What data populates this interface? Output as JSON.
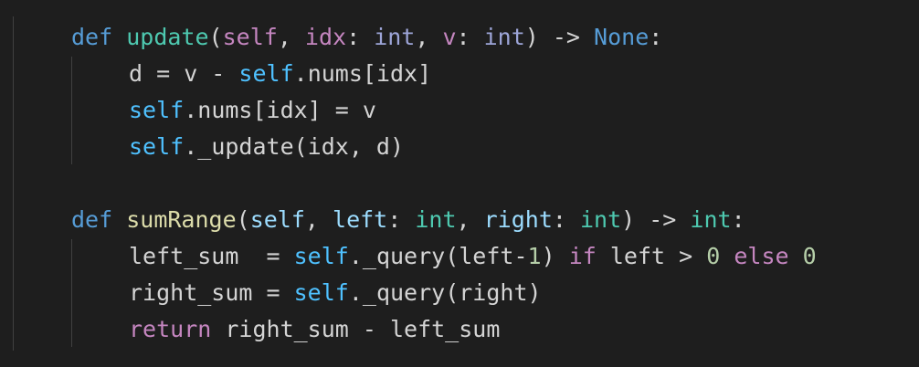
{
  "editor": {
    "language": "python",
    "theme": "dark",
    "lines": [
      {
        "indent": 1,
        "tokens": [
          {
            "t": "def",
            "k": "kw"
          },
          {
            "t": " ",
            "k": "txt"
          },
          {
            "t": "update",
            "k": "fn"
          },
          {
            "t": "(",
            "k": "txt"
          },
          {
            "t": "self",
            "k": "slf"
          },
          {
            "t": ", ",
            "k": "txt"
          },
          {
            "t": "idx",
            "k": "slf"
          },
          {
            "t": ": ",
            "k": "txt"
          },
          {
            "t": "int",
            "k": "typ"
          },
          {
            "t": ", ",
            "k": "txt"
          },
          {
            "t": "v",
            "k": "slf"
          },
          {
            "t": ": ",
            "k": "txt"
          },
          {
            "t": "int",
            "k": "typ"
          },
          {
            "t": ") -> ",
            "k": "txt"
          },
          {
            "t": "None",
            "k": "none"
          },
          {
            "t": ":",
            "k": "txt"
          }
        ]
      },
      {
        "indent": 2,
        "tokens": [
          {
            "t": "d = v - ",
            "k": "txt"
          },
          {
            "t": "self",
            "k": "self-ref"
          },
          {
            "t": ".nums[idx]",
            "k": "txt"
          }
        ]
      },
      {
        "indent": 2,
        "tokens": [
          {
            "t": "self",
            "k": "self-ref"
          },
          {
            "t": ".nums[idx] = v",
            "k": "txt"
          }
        ]
      },
      {
        "indent": 2,
        "tokens": [
          {
            "t": "self",
            "k": "self-ref"
          },
          {
            "t": "._update(idx, d)",
            "k": "txt"
          }
        ]
      },
      {
        "indent": 0,
        "tokens": []
      },
      {
        "indent": 1,
        "tokens": [
          {
            "t": "def",
            "k": "kw"
          },
          {
            "t": " ",
            "k": "txt"
          },
          {
            "t": "sumRange",
            "k": "fn2"
          },
          {
            "t": "(",
            "k": "txt"
          },
          {
            "t": "self",
            "k": "prm"
          },
          {
            "t": ", ",
            "k": "txt"
          },
          {
            "t": "left",
            "k": "prm"
          },
          {
            "t": ": ",
            "k": "txt"
          },
          {
            "t": "int",
            "k": "typ2"
          },
          {
            "t": ", ",
            "k": "txt"
          },
          {
            "t": "right",
            "k": "prm"
          },
          {
            "t": ": ",
            "k": "txt"
          },
          {
            "t": "int",
            "k": "typ2"
          },
          {
            "t": ") -> ",
            "k": "txt"
          },
          {
            "t": "int",
            "k": "typ2"
          },
          {
            "t": ":",
            "k": "txt"
          }
        ]
      },
      {
        "indent": 2,
        "tokens": [
          {
            "t": "left_sum  = ",
            "k": "txt"
          },
          {
            "t": "self",
            "k": "self-ref"
          },
          {
            "t": "._query(left-",
            "k": "txt"
          },
          {
            "t": "1",
            "k": "num"
          },
          {
            "t": ") ",
            "k": "txt"
          },
          {
            "t": "if",
            "k": "ctl"
          },
          {
            "t": " left > ",
            "k": "txt"
          },
          {
            "t": "0",
            "k": "num"
          },
          {
            "t": " ",
            "k": "txt"
          },
          {
            "t": "else",
            "k": "ctl"
          },
          {
            "t": " ",
            "k": "txt"
          },
          {
            "t": "0",
            "k": "num"
          }
        ]
      },
      {
        "indent": 2,
        "tokens": [
          {
            "t": "right_sum = ",
            "k": "txt"
          },
          {
            "t": "self",
            "k": "self-ref"
          },
          {
            "t": "._query(right)",
            "k": "txt"
          }
        ]
      },
      {
        "indent": 2,
        "tokens": [
          {
            "t": "return",
            "k": "ctl"
          },
          {
            "t": " right_sum - left_sum",
            "k": "txt"
          }
        ]
      }
    ]
  }
}
